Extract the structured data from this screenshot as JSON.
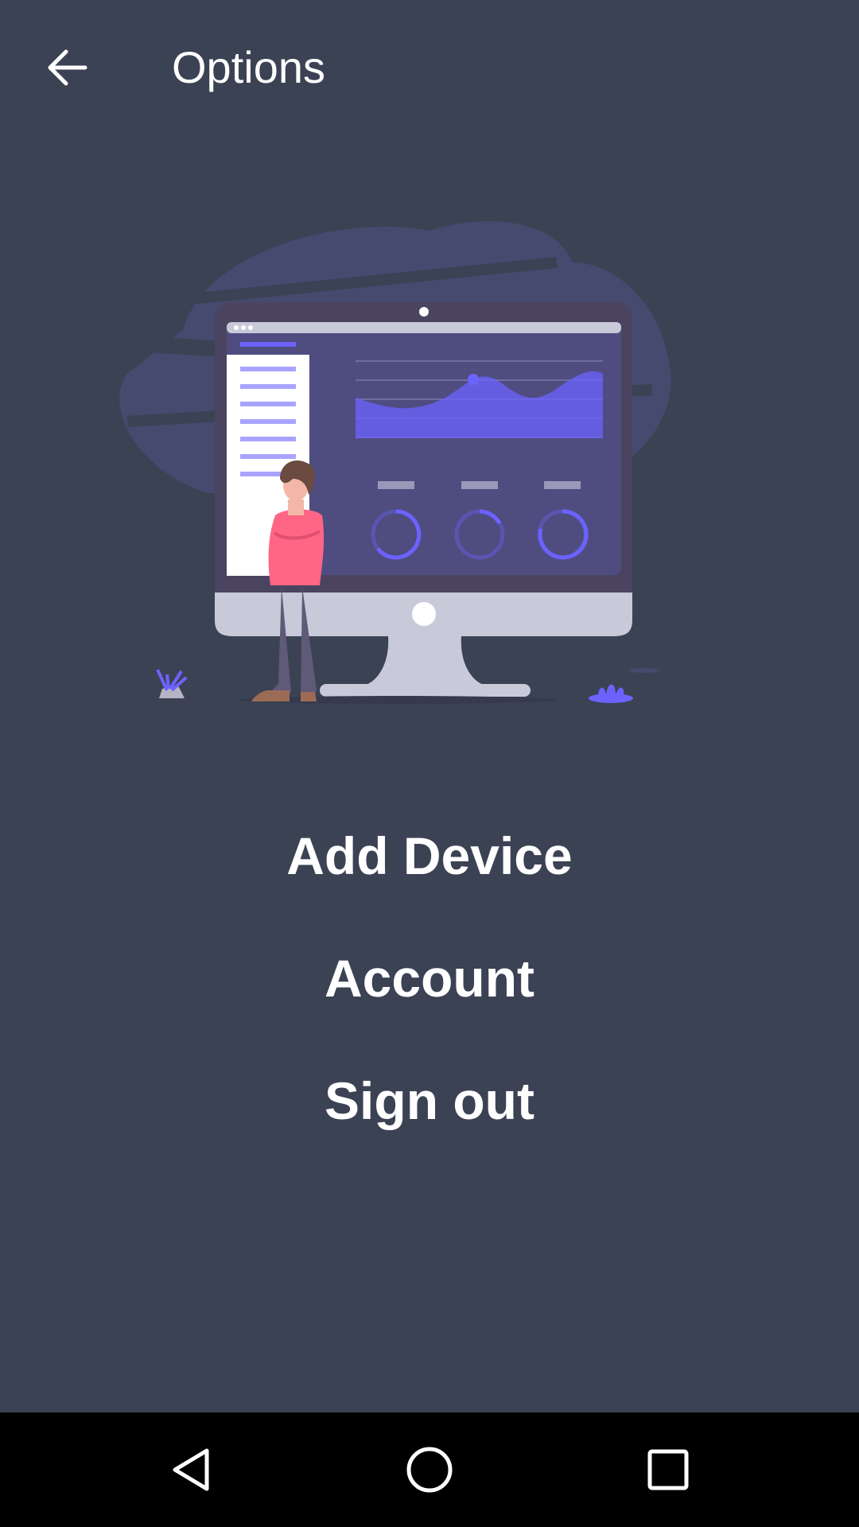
{
  "app_bar": {
    "back_icon": "arrow-back-icon",
    "title": "Options"
  },
  "hero": {
    "description_icon": "dashboard-illustration"
  },
  "menu": {
    "items": [
      {
        "label": "Add Device"
      },
      {
        "label": "Account"
      },
      {
        "label": "Sign out"
      }
    ]
  },
  "nav_bar": {
    "back_icon": "nav-back-triangle-icon",
    "home_icon": "nav-home-circle-icon",
    "recents_icon": "nav-recents-square-icon"
  },
  "colors": {
    "background": "#3b4254",
    "text": "#ffffff",
    "accent": "#6c63ff",
    "person_shirt": "#ff6584",
    "nav_bar": "#000000"
  }
}
